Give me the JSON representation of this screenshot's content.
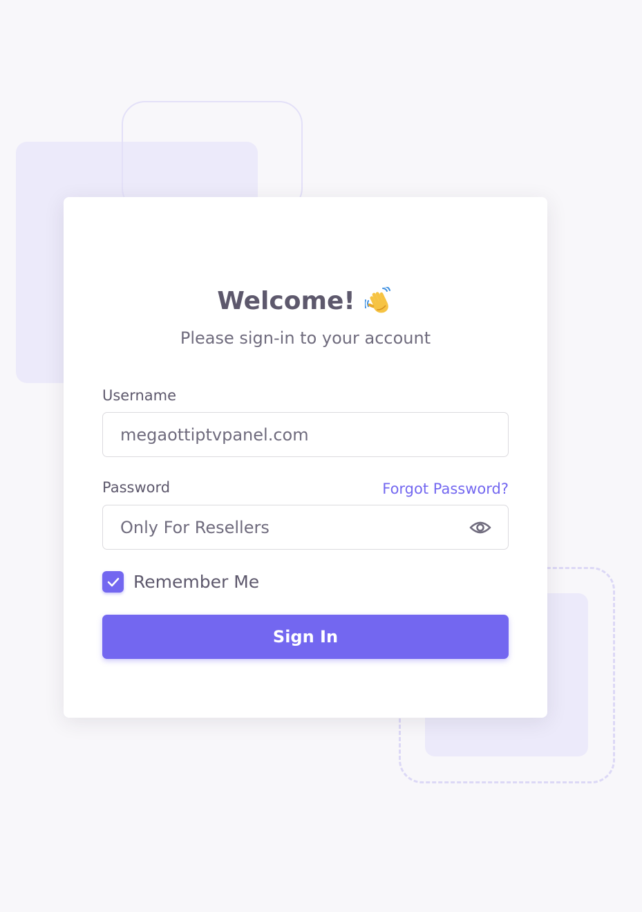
{
  "welcome": {
    "title": "Welcome!",
    "emoji": "waving-hand-icon",
    "subtitle": "Please sign-in to your account"
  },
  "form": {
    "username_label": "Username",
    "username_value": "megaottiptvpanel.com",
    "password_label": "Password",
    "forgot_password": "Forgot Password?",
    "password_value": "Only For Resellers",
    "show_password_icon": "eye-icon",
    "remember_me": "Remember Me",
    "remember_checked": true,
    "sign_in": "Sign In"
  },
  "colors": {
    "primary": "#7367f0",
    "heading": "#5d586c",
    "body_text": "#6f6b7d",
    "page_background": "#f8f7fa",
    "decor": "#eceafa"
  }
}
